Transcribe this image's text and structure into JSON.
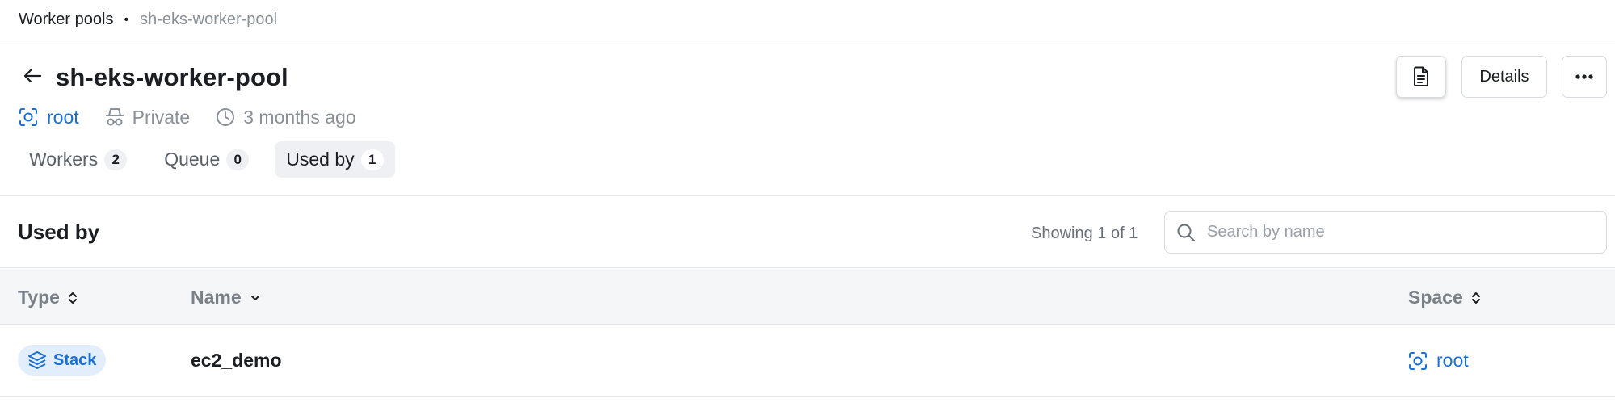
{
  "breadcrumb": {
    "parent": "Worker pools",
    "separator": "•",
    "current": "sh-eks-worker-pool"
  },
  "header": {
    "title": "sh-eks-worker-pool",
    "meta": {
      "space": "root",
      "visibility": "Private",
      "created": "3 months ago"
    },
    "buttons": {
      "details_label": "Details"
    }
  },
  "tabs": [
    {
      "label": "Workers",
      "count": "2",
      "active": false
    },
    {
      "label": "Queue",
      "count": "0",
      "active": false
    },
    {
      "label": "Used by",
      "count": "1",
      "active": true
    }
  ],
  "section": {
    "title": "Used by",
    "showing": "Showing 1 of 1",
    "search_placeholder": "Search by name"
  },
  "table": {
    "columns": [
      {
        "label": "Type",
        "sort": "both"
      },
      {
        "label": "Name",
        "sort": "desc"
      },
      {
        "label": "Space",
        "sort": "both"
      }
    ],
    "rows": [
      {
        "type": "Stack",
        "name": "ec2_demo",
        "space": "root"
      }
    ]
  },
  "colors": {
    "accent": "#1a6fd6",
    "muted": "#8a9098",
    "border": "#e4e6ea",
    "header_bg": "#f5f6f8"
  },
  "icons": {
    "back": "arrow-left-icon",
    "space": "space-icon",
    "visibility": "incognito-icon",
    "time": "clock-icon",
    "document": "document-icon",
    "more": "more-horizontal-icon",
    "search": "search-icon",
    "stack": "stack-layers-icon",
    "sort": "sort-icon"
  }
}
